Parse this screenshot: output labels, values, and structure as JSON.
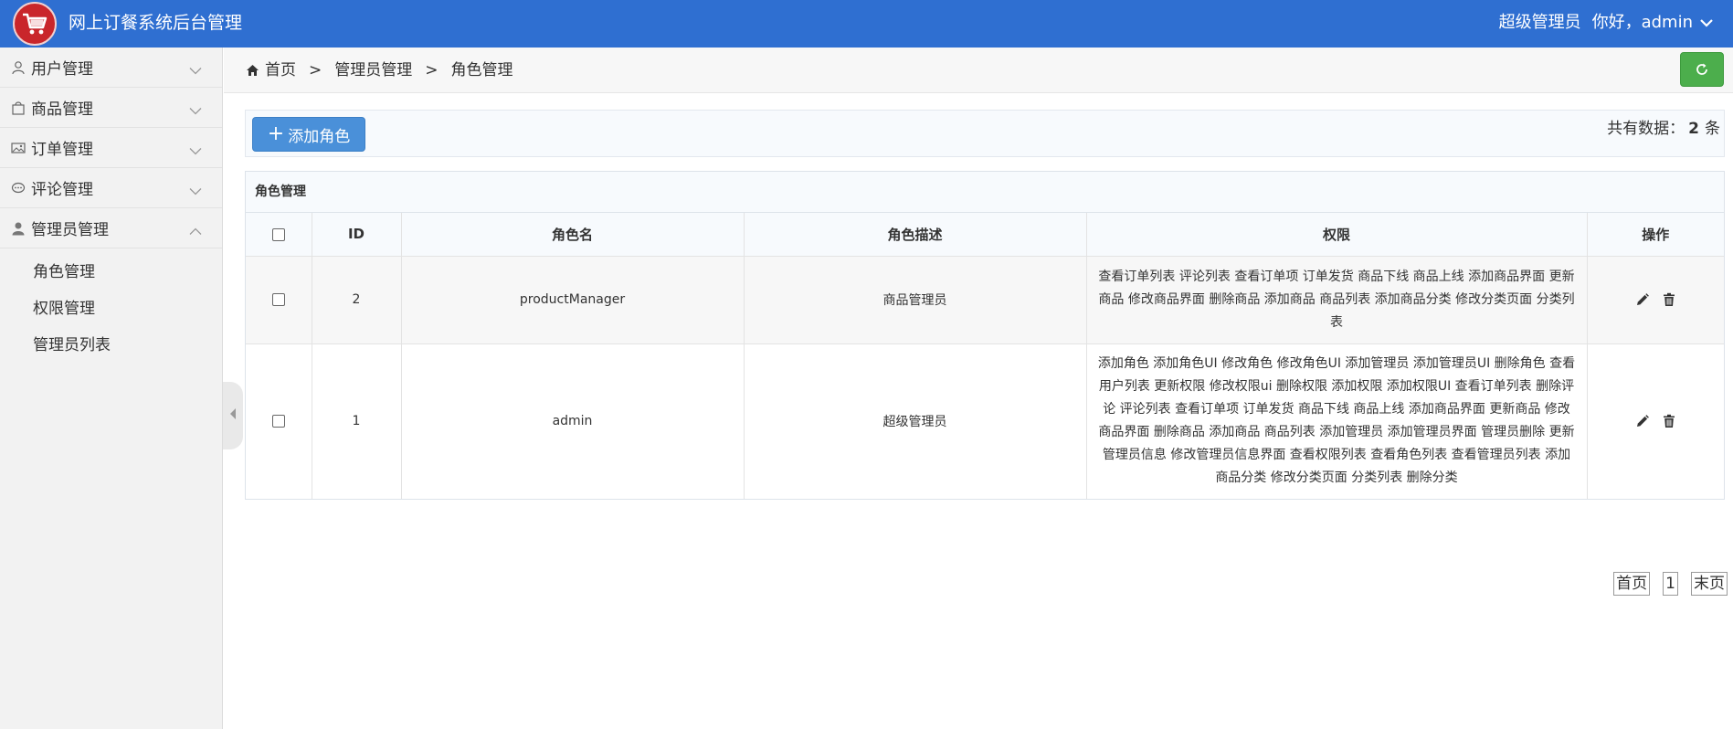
{
  "header": {
    "app_title": "网上订餐系统后台管理",
    "user_role": "超级管理员",
    "greeting": "你好，admin"
  },
  "sidebar": {
    "items": [
      {
        "label": "用户管理",
        "icon": "user-icon",
        "expanded": false
      },
      {
        "label": "商品管理",
        "icon": "shopping-bag-icon",
        "expanded": false
      },
      {
        "label": "订单管理",
        "icon": "image-icon",
        "expanded": false
      },
      {
        "label": "评论管理",
        "icon": "comment-icon",
        "expanded": false
      },
      {
        "label": "管理员管理",
        "icon": "admin-user-icon",
        "expanded": true
      }
    ],
    "subitems": [
      "角色管理",
      "权限管理",
      "管理员列表"
    ]
  },
  "breadcrumb": {
    "home": "首页",
    "separator": ">",
    "level1": "管理员管理",
    "level2": "角色管理"
  },
  "toolbar": {
    "add_label": "添加角色",
    "total_prefix": "共有数据：",
    "total_count": "2",
    "total_suffix": "条"
  },
  "table": {
    "title": "角色管理",
    "headers": [
      "ID",
      "角色名",
      "角色描述",
      "权限",
      "操作"
    ],
    "rows": [
      {
        "id": "2",
        "name": "productManager",
        "description": "商品管理员",
        "permissions": "查看订单列表 评论列表 查看订单项 订单发货 商品下线 商品上线 添加商品界面 更新商品 修改商品界面 删除商品 添加商品 商品列表 添加商品分类 修改分类页面 分类列表"
      },
      {
        "id": "1",
        "name": "admin",
        "description": "超级管理员",
        "permissions": "添加角色 添加角色UI 修改角色 修改角色UI 添加管理员 添加管理员UI 删除角色 查看用户列表 更新权限 修改权限ui 删除权限 添加权限 添加权限UI 查看订单列表 删除评论 评论列表 查看订单项 订单发货 商品下线 商品上线 添加商品界面 更新商品 修改商品界面 删除商品 添加商品 商品列表 添加管理员 添加管理员界面 管理员删除 更新管理员信息 修改管理员信息界面 查看权限列表 查看角色列表 查看管理员列表 添加商品分类 修改分类页面 分类列表 删除分类"
      }
    ]
  },
  "pagination": {
    "first": "首页",
    "current": "1",
    "last": "末页"
  },
  "colors": {
    "header_bg": "#2f6fd1",
    "add_button": "#4a90d9",
    "refresh_button": "#4cae4c"
  }
}
